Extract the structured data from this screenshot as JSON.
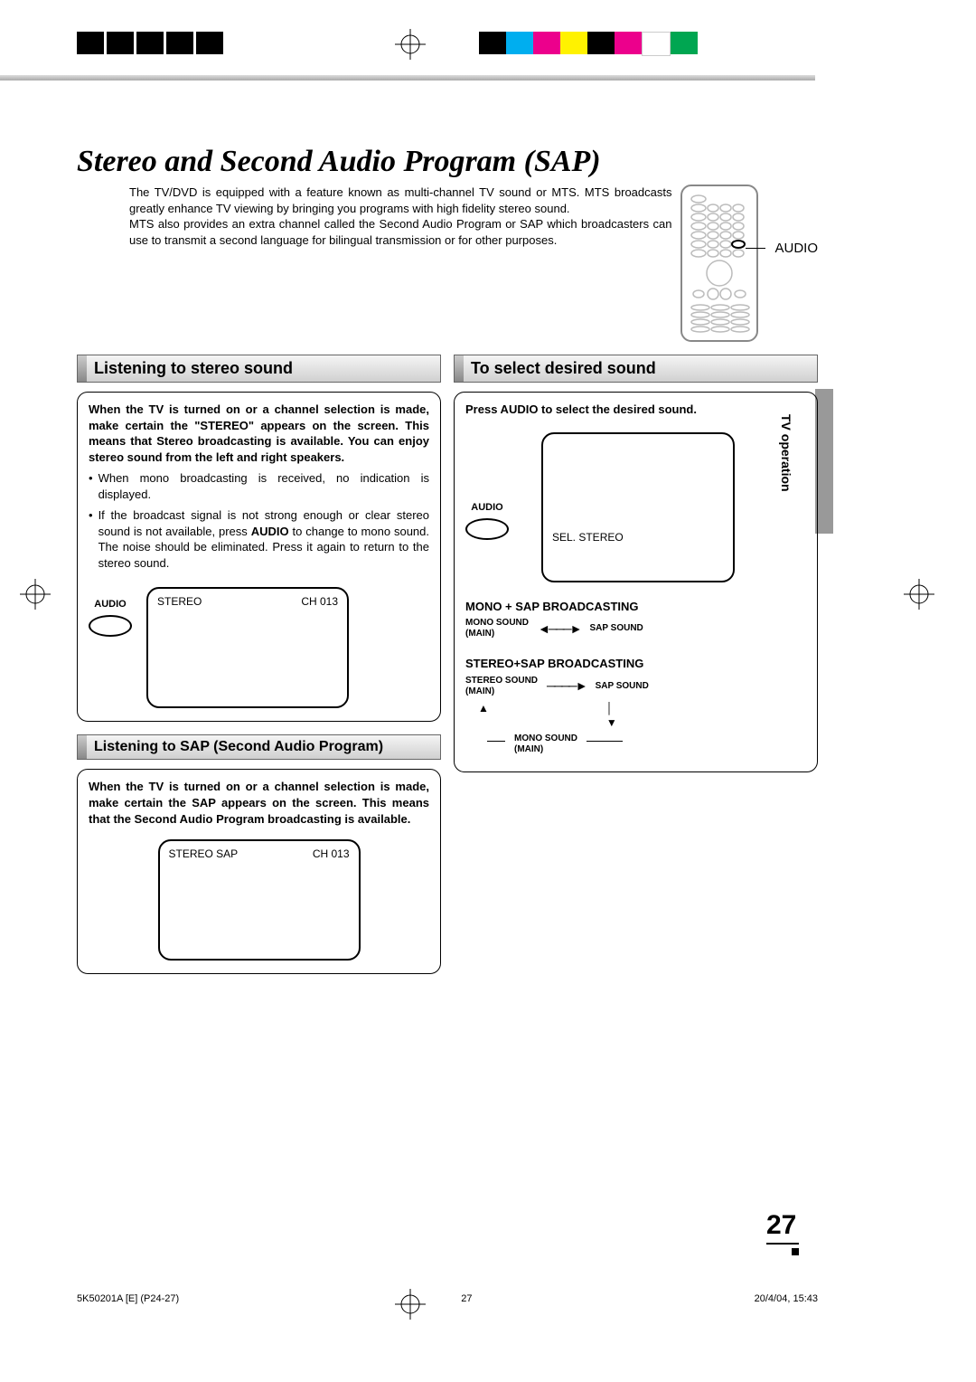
{
  "title": "Stereo and Second Audio Program (SAP)",
  "intro": "The TV/DVD is equipped with a feature known as multi-channel TV sound or MTS. MTS broadcasts greatly enhance TV viewing by bringing you programs with high fidelity stereo sound.\nMTS also provides an extra channel called the Second Audio Program or SAP which broadcasters can use to transmit a second language for bilingual transmission or for other purposes.",
  "remote_label": "AUDIO",
  "side_tab": "TV operation",
  "sections": {
    "stereo": {
      "heading": "Listening to stereo sound",
      "bold_intro": "When the TV is turned on or a channel selection is made, make certain the \"STEREO\" appears on the screen. This means that Stereo broadcasting is available. You can enjoy stereo sound from the left and right speakers.",
      "bullet1": "When mono broadcasting is received, no indication is displayed.",
      "bullet2_pre": "If the broadcast signal is not strong enough or clear stereo sound is not available, press ",
      "bullet2_btn": "AUDIO",
      "bullet2_post": " to change to mono sound. The noise should be eliminated. Press it again to return to the stereo sound.",
      "audio_btn": "AUDIO",
      "screen": {
        "left": "STEREO",
        "right": "CH 013"
      }
    },
    "sap": {
      "heading": "Listening to SAP (Second Audio Program)",
      "bold_intro": "When the TV is turned on or a channel selection is made, make certain the SAP appears on the screen. This means that the Second Audio Program broadcasting is available.",
      "screen": {
        "left": "STEREO  SAP",
        "right": "CH 013"
      }
    },
    "select": {
      "heading": "To select desired sound",
      "instruction": "Press AUDIO to select the desired sound.",
      "audio_btn": "AUDIO",
      "screen_text": "SEL. STEREO",
      "diag1_title": "MONO + SAP BROADCASTING",
      "diag1_left": "MONO SOUND\n(MAIN)",
      "diag1_right": "SAP SOUND",
      "diag2_title": "STEREO+SAP BROADCASTING",
      "diag2_a": "STEREO SOUND\n(MAIN)",
      "diag2_b": "SAP SOUND",
      "diag2_c": "MONO SOUND\n(MAIN)"
    }
  },
  "page_number": "27",
  "footer": {
    "left": "5K50201A [E] (P24-27)",
    "center": "27",
    "right": "20/4/04, 15:43"
  },
  "reg_colors": [
    "#000000",
    "#00aeef",
    "#ec008c",
    "#fff200",
    "#000000",
    "#ec008c",
    "#ffffff",
    "#00a651"
  ]
}
